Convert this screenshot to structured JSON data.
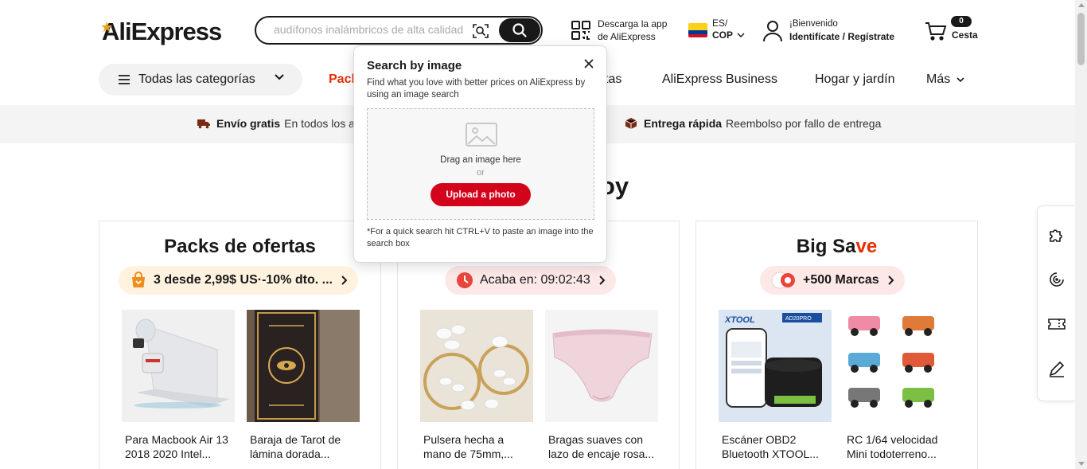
{
  "header": {
    "logo": "AliExpress",
    "search": {
      "placeholder": "audífonos inalámbricos de alta calidad"
    },
    "app_download": {
      "line1": "Descarga la app",
      "line2": "de AliExpress"
    },
    "locale": {
      "language": "ES/",
      "currency": "COP"
    },
    "user": {
      "greeting": "¡Bienvenido",
      "action": "Identifícate / Regístrate"
    },
    "cart": {
      "count": "0",
      "label": "Cesta"
    }
  },
  "nav": {
    "categories_label": "Todas las categorías",
    "items": [
      {
        "label": "Pack",
        "highlight": true
      },
      {
        "label": "tas"
      },
      {
        "label": "AliExpress Business"
      },
      {
        "label": "Hogar y jardín"
      },
      {
        "label": "Más"
      }
    ]
  },
  "promo_strip": [
    {
      "bold": "Envío gratis",
      "text": "En todos los ar"
    },
    {
      "bold": "Entrega rápida",
      "text": "Reembolso por fallo de entrega"
    }
  ],
  "section_title_visible": "oy",
  "cards": [
    {
      "title": "Packs de ofertas",
      "pill": "3 desde 2,99$ US·-10% dto. ...",
      "pill_color": "#fff3e0",
      "products": [
        {
          "name_line1": "Para Macbook Air 13",
          "name_line2": "2018 2020 Intel..."
        },
        {
          "name_line1": "Baraja de Tarot de",
          "name_line2": "lámina dorada..."
        }
      ]
    },
    {
      "title": "",
      "pill": "Acaba en: 09:02:43",
      "pill_color": "#fde8e8",
      "products": [
        {
          "name_line1": "Pulsera hecha a",
          "name_line2": "mano de 75mm,..."
        },
        {
          "name_line1": "Bragas suaves con",
          "name_line2": "lazo de encaje rosa..."
        }
      ]
    },
    {
      "title_part1": "Big Sa",
      "title_part2": "ve",
      "pill": "+500 Marcas",
      "pill_color": "#fde8e8",
      "products": [
        {
          "name_line1": "Escáner OBD2",
          "name_line2": "Bluetooth XTOOL..."
        },
        {
          "name_line1": "RC 1/64 velocidad",
          "name_line2": "Mini todoterreno..."
        }
      ]
    }
  ],
  "popup": {
    "title": "Search by image",
    "description": "Find what you love with better prices on AliExpress by using an image search",
    "drag_text": "Drag an image here",
    "or_text": "or",
    "upload_label": "Upload a photo",
    "hint": "*For a quick search hit CTRL+V to paste an image into the search box"
  },
  "product_image_text": {
    "xtool_brand": "XTOOL",
    "xtool_model": "AD20PRO"
  },
  "colors": {
    "accent_red": "#e62e04",
    "upload_red": "#d3031c",
    "dark": "#191919"
  }
}
